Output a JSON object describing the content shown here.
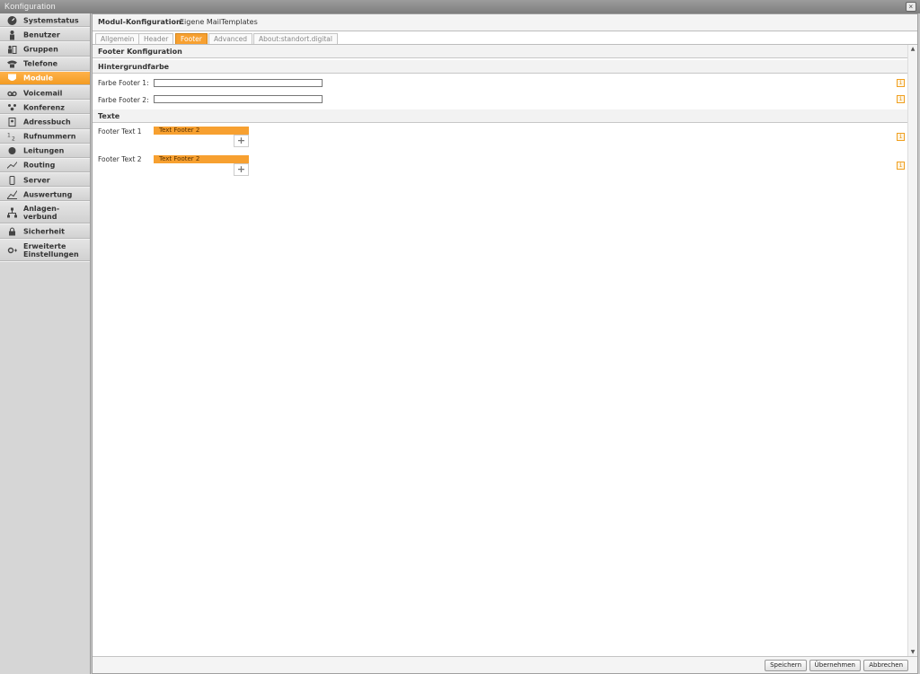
{
  "window": {
    "title": "Konfiguration",
    "close_glyph": "×"
  },
  "sidebar": {
    "items": [
      {
        "label": "Systemstatus",
        "icon": "dashboard-icon"
      },
      {
        "label": "Benutzer",
        "icon": "user-icon"
      },
      {
        "label": "Gruppen",
        "icon": "group-icon"
      },
      {
        "label": "Telefone",
        "icon": "phone-icon"
      },
      {
        "label": "Module",
        "icon": "module-icon",
        "active": true
      },
      {
        "label": "Voicemail",
        "icon": "voicemail-icon"
      },
      {
        "label": "Konferenz",
        "icon": "conference-icon"
      },
      {
        "label": "Adressbuch",
        "icon": "addressbook-icon"
      },
      {
        "label": "Rufnummern",
        "icon": "numbers-icon"
      },
      {
        "label": "Leitungen",
        "icon": "lines-icon"
      },
      {
        "label": "Routing",
        "icon": "routing-icon"
      },
      {
        "label": "Server",
        "icon": "server-icon"
      },
      {
        "label": "Auswertung",
        "icon": "chart-icon"
      },
      {
        "label": "Anlagen-\nverbund",
        "icon": "network-icon"
      },
      {
        "label": "Sicherheit",
        "icon": "lock-icon"
      },
      {
        "label": "Erweiterte\nEinstellungen",
        "icon": "gear-plus-icon"
      }
    ]
  },
  "header": {
    "label": "Modul-Konfiguration:",
    "name": "Eigene MailTemplates"
  },
  "tabs": [
    "Allgemein",
    "Header",
    "Footer",
    "Advanced",
    "About:standort.digital"
  ],
  "active_tab": "Footer",
  "sections": {
    "footer_config": "Footer Konfiguration",
    "background": "Hintergrundfarbe",
    "texts": "Texte"
  },
  "fields": {
    "color1_label": "Farbe Footer 1:",
    "color1_value": "",
    "color2_label": "Farbe Footer 2:",
    "color2_value": "",
    "text1_label": "Footer Text 1",
    "text1_chip": "Text Footer 2",
    "text2_label": "Footer Text 2",
    "text2_chip": "Text Footer 2",
    "add_glyph": "+",
    "info_glyph": "i"
  },
  "buttons": {
    "save": "Speichern",
    "apply": "Übernehmen",
    "cancel": "Abbrechen"
  },
  "colors": {
    "accent": "#f7a030",
    "sidebar_bg": "#d6d6d6",
    "titlebar": "#8a8a8a"
  }
}
